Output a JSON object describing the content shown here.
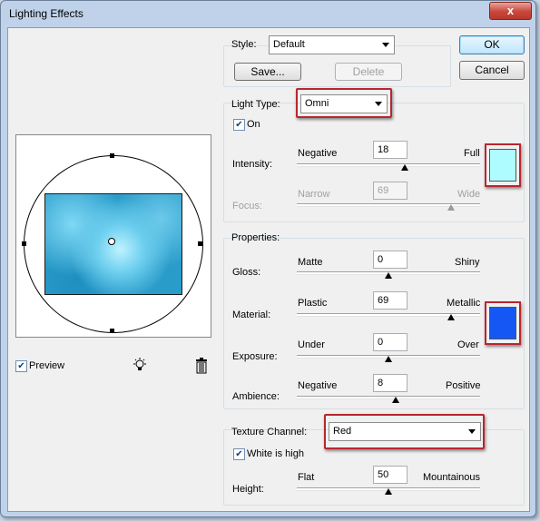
{
  "window": {
    "title": "Lighting Effects",
    "close_label": "x"
  },
  "style": {
    "label": "Style:",
    "value": "Default",
    "save_label": "Save...",
    "delete_label": "Delete"
  },
  "buttons": {
    "ok": "OK",
    "cancel": "Cancel"
  },
  "light_type": {
    "label": "Light Type:",
    "value": "Omni",
    "on_label": "On",
    "on_checked": true,
    "intensity": {
      "label": "Intensity:",
      "min_label": "Negative",
      "max_label": "Full",
      "value": "18",
      "level": 0.59
    },
    "focus": {
      "label": "Focus:",
      "min_label": "Narrow",
      "max_label": "Wide",
      "value": "69",
      "level": 0.84,
      "enabled": false
    },
    "color": "#aefcff"
  },
  "properties": {
    "title": "Properties:",
    "gloss": {
      "label": "Gloss:",
      "min_label": "Matte",
      "max_label": "Shiny",
      "value": "0",
      "level": 0.5
    },
    "material": {
      "label": "Material:",
      "min_label": "Plastic",
      "max_label": "Metallic",
      "value": "69",
      "level": 0.84
    },
    "exposure": {
      "label": "Exposure:",
      "min_label": "Under",
      "max_label": "Over",
      "value": "0",
      "level": 0.5
    },
    "ambience": {
      "label": "Ambience:",
      "min_label": "Negative",
      "max_label": "Positive",
      "value": "8",
      "level": 0.54
    },
    "color": "#1457f5"
  },
  "texture": {
    "label": "Texture Channel:",
    "value": "Red",
    "white_high_label": "White is high",
    "white_high_checked": true,
    "height": {
      "label": "Height:",
      "min_label": "Flat",
      "max_label": "Mountainous",
      "value": "50",
      "level": 0.5
    }
  },
  "preview": {
    "label": "Preview",
    "checked": true,
    "light_icon": "light-bulb-icon",
    "trash_icon": "trash-icon"
  }
}
